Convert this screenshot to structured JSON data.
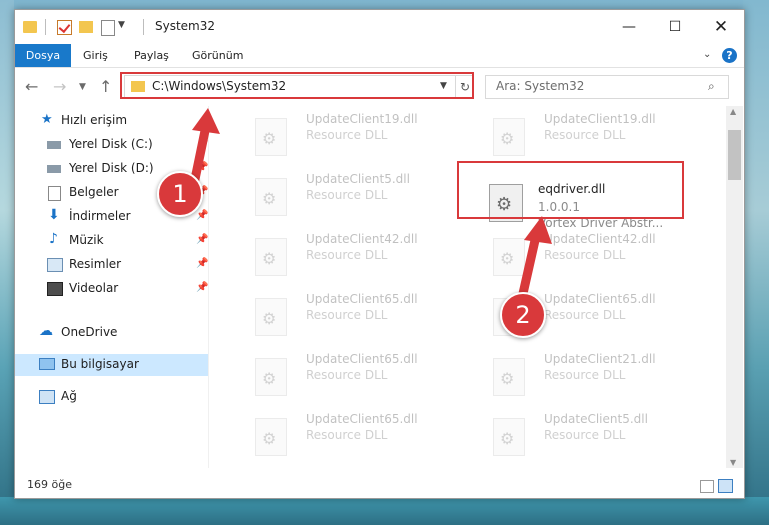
{
  "window": {
    "title": "System32"
  },
  "ribbon": {
    "tabs": [
      "Dosya",
      "Giriş",
      "Paylaş",
      "Görünüm"
    ]
  },
  "address": {
    "path": "C:\\Windows\\System32"
  },
  "search": {
    "placeholder": "Ara: System32"
  },
  "sidebar": {
    "items": [
      {
        "label": "Hızlı erişim",
        "icon": "star-icon"
      },
      {
        "label": "Yerel Disk (C:)",
        "icon": "drive-icon"
      },
      {
        "label": "Yerel Disk (D:)",
        "icon": "drive-icon"
      },
      {
        "label": "Belgeler",
        "icon": "documents-icon"
      },
      {
        "label": "İndirmeler",
        "icon": "download-icon"
      },
      {
        "label": "Müzik",
        "icon": "music-icon"
      },
      {
        "label": "Resimler",
        "icon": "pictures-icon"
      },
      {
        "label": "Videolar",
        "icon": "video-icon"
      },
      {
        "label": "OneDrive",
        "icon": "cloud-icon"
      },
      {
        "label": "Bu bilgisayar",
        "icon": "computer-icon"
      },
      {
        "label": "Ağ",
        "icon": "network-icon"
      }
    ]
  },
  "files": [
    {
      "name": "UpdateClient19.dll",
      "desc": "Resource DLL"
    },
    {
      "name": "UpdateClient19.dll",
      "desc": "Resource DLL"
    },
    {
      "name": "UpdateClient5.dll",
      "desc": "Resource DLL"
    },
    {
      "name": "UpdateClient42.dll",
      "desc": "Resource DLL"
    },
    {
      "name": "UpdateClient42.dll",
      "desc": "Resource DLL"
    },
    {
      "name": "UpdateClient65.dll",
      "desc": "Resource DLL"
    },
    {
      "name": "UpdateClient65.dll",
      "desc": "Resource DLL"
    },
    {
      "name": "UpdateClient65.dll",
      "desc": "Resource DLL"
    },
    {
      "name": "UpdateClient21.dll",
      "desc": "Resource DLL"
    },
    {
      "name": "UpdateClient65.dll",
      "desc": "Resource DLL"
    },
    {
      "name": "UpdateClient5.dll",
      "desc": "Resource DLL"
    }
  ],
  "highlighted_file": {
    "name": "eqdriver.dll",
    "version": "1.0.0.1",
    "desc": "Vortex Driver Abstr..."
  },
  "status": {
    "count": "169 öğe"
  },
  "callouts": {
    "one": "1",
    "two": "2"
  },
  "colors": {
    "accent": "#1979ca",
    "highlight_red": "#d9393b"
  }
}
